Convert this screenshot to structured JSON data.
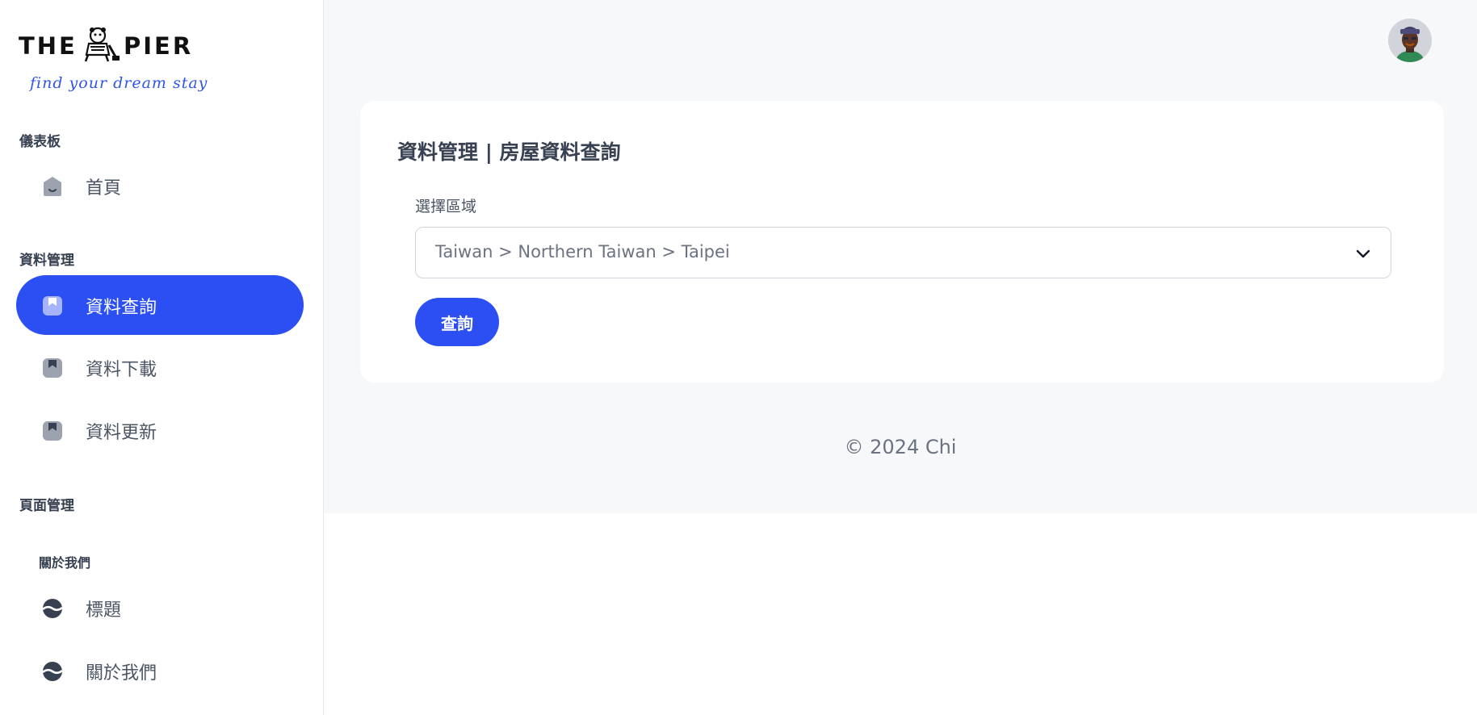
{
  "logo": {
    "left_text": "THE",
    "right_text": "PIER",
    "tagline": "find your dream stay",
    "tagline_color": "#2f55e6"
  },
  "sidebar": {
    "sections": [
      {
        "label": "儀表板",
        "items": [
          {
            "label": "首頁",
            "icon": "home-icon",
            "active": false
          }
        ]
      },
      {
        "label": "資料管理",
        "items": [
          {
            "label": "資料查詢",
            "icon": "bookmark-icon",
            "active": true
          },
          {
            "label": "資料下載",
            "icon": "bookmark-icon",
            "active": false
          },
          {
            "label": "資料更新",
            "icon": "bookmark-icon",
            "active": false
          }
        ]
      },
      {
        "label": "頁面管理",
        "subsections": [
          {
            "label": "關於我們",
            "items": [
              {
                "label": "標題",
                "icon": "planet-icon",
                "active": false
              },
              {
                "label": "關於我們",
                "icon": "planet-icon",
                "active": false
              }
            ]
          }
        ]
      }
    ]
  },
  "header": {
    "avatar": "user-avatar"
  },
  "main": {
    "title": "資料管理 | 房屋資料查詢",
    "region_label": "選擇區域",
    "region_value": "Taiwan > Northern Taiwan > Taipei",
    "query_button": "查詢"
  },
  "footer": {
    "text": "© 2024 Chi"
  },
  "colors": {
    "accent": "#2b4ff2",
    "background": "#f7f8fa",
    "card": "#ffffff",
    "text": "#374151"
  }
}
